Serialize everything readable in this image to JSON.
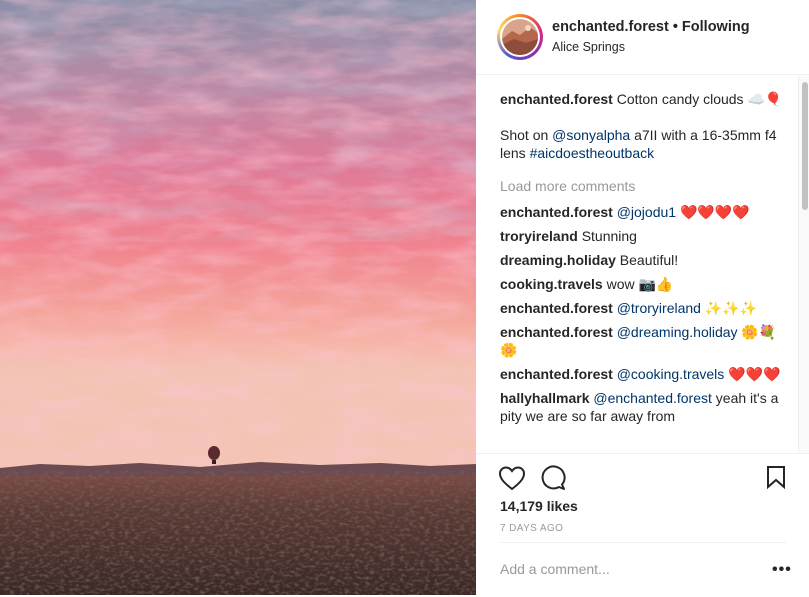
{
  "post": {
    "username": "enchanted.forest",
    "separator": "•",
    "follow_status": "Following",
    "location": "Alice Springs",
    "icon": "hot-air-balloon-icon"
  },
  "caption": {
    "username": "enchanted.forest",
    "text": "Cotton candy clouds ☁️🎈",
    "line2_prefix": "Shot on ",
    "mention": "@sonyalpha",
    "line2_mid": " a7II with a 16-35mm f4 lens ",
    "hashtag": "#aicdoestheoutback"
  },
  "load_more": "Load more comments",
  "comments": [
    {
      "user": "enchanted.forest",
      "mention": "@jojodu1",
      "text": " ❤️❤️❤️❤️"
    },
    {
      "user": "troryireland",
      "mention": "",
      "text": " Stunning"
    },
    {
      "user": "dreaming.holiday",
      "mention": "",
      "text": " Beautiful!"
    },
    {
      "user": "cooking.travels",
      "mention": "",
      "text": " wow 📷👍"
    },
    {
      "user": "enchanted.forest",
      "mention": "@troryireland",
      "text": " ✨✨✨"
    },
    {
      "user": "enchanted.forest",
      "mention": "@dreaming.holiday",
      "text": " 🌼💐🌼"
    },
    {
      "user": "enchanted.forest",
      "mention": "@cooking.travels",
      "text": " ❤️❤️❤️"
    },
    {
      "user": "hallyhallmark",
      "mention": "@enchanted.forest",
      "text": " yeah it's a pity we are so far away from"
    }
  ],
  "likes": "14,179 likes",
  "time_ago": "7 DAYS AGO",
  "add_comment_placeholder": "Add a comment...",
  "more_options": "•••",
  "icons": {
    "like": "heart-icon",
    "comment": "comment-icon",
    "save": "bookmark-icon"
  }
}
